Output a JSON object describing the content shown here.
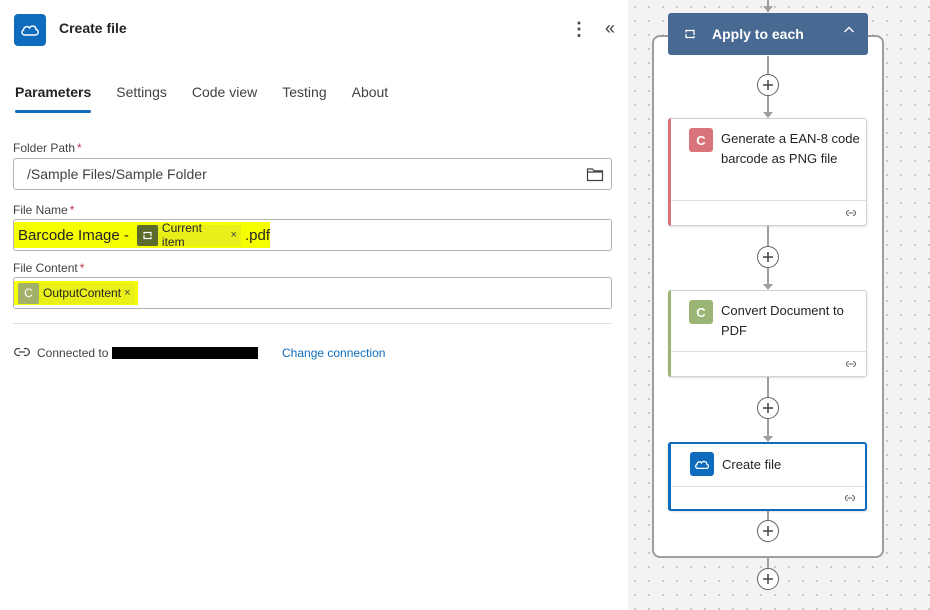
{
  "panel": {
    "title": "Create file",
    "icon": "onedrive-cloud-icon",
    "tabs": [
      {
        "label": "Parameters",
        "active": true
      },
      {
        "label": "Settings",
        "active": false
      },
      {
        "label": "Code view",
        "active": false
      },
      {
        "label": "Testing",
        "active": false
      },
      {
        "label": "About",
        "active": false
      }
    ],
    "fields": {
      "folder_path": {
        "label": "Folder Path",
        "required": "*",
        "value": "/Sample Files/Sample Folder"
      },
      "file_name": {
        "label": "File Name",
        "required": "*",
        "prefix": "Barcode Image - ",
        "token": "Current item",
        "suffix": ".pdf"
      },
      "file_content": {
        "label": "File Content",
        "required": "*",
        "token": "OutputContent"
      }
    },
    "connection": {
      "label": "Connected to",
      "change_link": "Change connection"
    }
  },
  "canvas": {
    "loop": {
      "title": "Apply to each",
      "color": "#486991"
    },
    "cards": [
      {
        "title": "Generate a EAN-8 code barcode as PNG file",
        "icon_letter": "C",
        "accent": "#d9747a"
      },
      {
        "title": "Convert Document to PDF",
        "icon_letter": "C",
        "accent": "#9ab574"
      },
      {
        "title": "Create file",
        "icon": "onedrive-cloud-icon",
        "accent": "#0f6cbd",
        "selected": true
      }
    ]
  },
  "token_close": "×"
}
